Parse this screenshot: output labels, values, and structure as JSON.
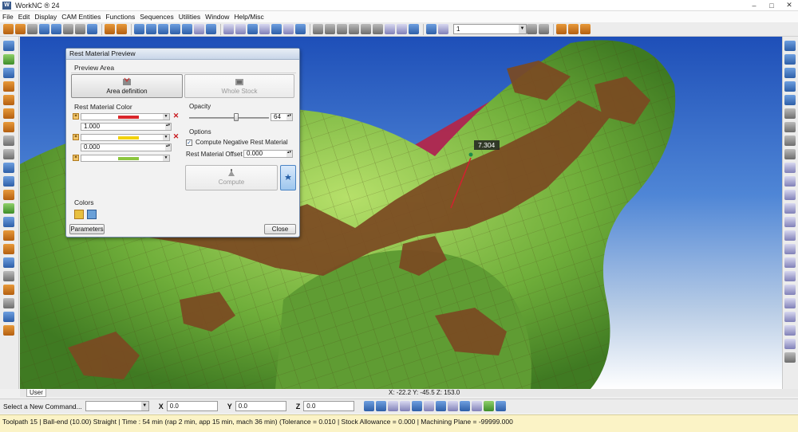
{
  "window": {
    "title": "WorkNC ® 24",
    "controls": [
      "–",
      "□",
      "✕"
    ]
  },
  "menu": [
    "File",
    "Edit",
    "Display",
    "CAM Entities",
    "Functions",
    "Sequences",
    "Utilities",
    "Window",
    "Help/Misc"
  ],
  "toolbar": {
    "layer_combo_value": "1"
  },
  "viewport": {
    "measurement_label": "7.304",
    "colors": {
      "green_stock": "#6fae3a",
      "brown_rest": "#7b4a22",
      "red_rest": "#c01f3c",
      "sky_top": "#1e4fb8"
    }
  },
  "dialog": {
    "title": "Rest Material Preview",
    "preview_area_label": "Preview Area",
    "area_definition_button": "Area definition",
    "whole_stock_button": "Whole Stock",
    "rest_material_color_label": "Rest Material Color",
    "color_rows": [
      {
        "swatch": "#d9262c"
      },
      {
        "value": "1.000",
        "swatch": "#f2d20c"
      },
      {
        "value": "0.000",
        "swatch": "#8cc63f"
      }
    ],
    "opacity_label": "Opacity",
    "opacity_value": "64",
    "options_label": "Options",
    "compute_negative_label": "Compute Negative Rest Material",
    "compute_negative_checked": "✓",
    "offset_label": "Rest Material Offset",
    "offset_value": "0.000",
    "compute_button": "Compute",
    "colors_label": "Colors",
    "parameters_button": "Parameters",
    "close_button": "Close"
  },
  "coords_bar": {
    "user_tab": "User",
    "readout": "X: -22.2   Y: -45.5   Z: 153.0"
  },
  "command_bar": {
    "label": "Select a New Command...",
    "x_label": "X",
    "x_value": "0.0",
    "y_label": "Y",
    "y_value": "0.0",
    "z_label": "Z",
    "z_value": "0.0"
  },
  "status": {
    "text": "Toolpath 15 | Ball-end (10.00) Straight | Time : 54 min (rap 2 min, app 15 min, mach 36 min) (Tolerance = 0.010 | Stock Allowance = 0.000 | Machining Plane = -99999.000"
  }
}
